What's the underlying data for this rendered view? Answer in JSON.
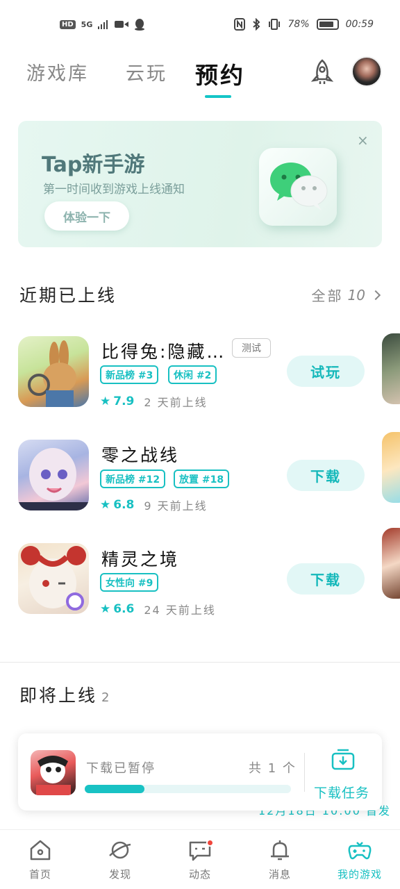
{
  "status_bar": {
    "hd": "HD",
    "net": "5G",
    "battery": "78%",
    "time": "00:59"
  },
  "tabs": [
    {
      "label": "游戏库",
      "active": false
    },
    {
      "label": "云玩",
      "active": false
    },
    {
      "label": "预约",
      "active": true
    }
  ],
  "banner": {
    "title": "Tap新手游",
    "subtitle": "第一时间收到游戏上线通知",
    "button": "体验一下",
    "close": "×"
  },
  "recent": {
    "title": "近期已上线",
    "all_label": "全部",
    "count": "10",
    "games": [
      {
        "name": "比得兔:隐藏…",
        "badge": "测试",
        "tags": [
          "新品榜 #3",
          "休闲 #2"
        ],
        "rating": "7.9",
        "since": "2 天前上线",
        "action": "试玩"
      },
      {
        "name": "零之战线",
        "tags": [
          "新品榜 #12",
          "放置 #18"
        ],
        "rating": "6.8",
        "since": "9 天前上线",
        "action": "下载"
      },
      {
        "name": "精灵之境",
        "tags": [
          "女性向 #9"
        ],
        "rating": "6.6",
        "since": "24 天前上线",
        "action": "下载"
      }
    ]
  },
  "upcoming": {
    "title": "即将上线",
    "count": "2",
    "peek_text": "12月18日 10:00 首发"
  },
  "download": {
    "status": "下载已暂停",
    "total": "共 1 个",
    "progress": 0.29,
    "task_label": "下载任务"
  },
  "nav": [
    {
      "label": "首页",
      "icon": "home-icon"
    },
    {
      "label": "发现",
      "icon": "planet-icon"
    },
    {
      "label": "动态",
      "icon": "chat-icon",
      "dot": true
    },
    {
      "label": "消息",
      "icon": "bell-icon"
    },
    {
      "label": "我的游戏",
      "icon": "gamepad-icon",
      "active": true
    }
  ],
  "colors": {
    "accent": "#18c0c2",
    "banner_bg": "#e2f5ee"
  }
}
